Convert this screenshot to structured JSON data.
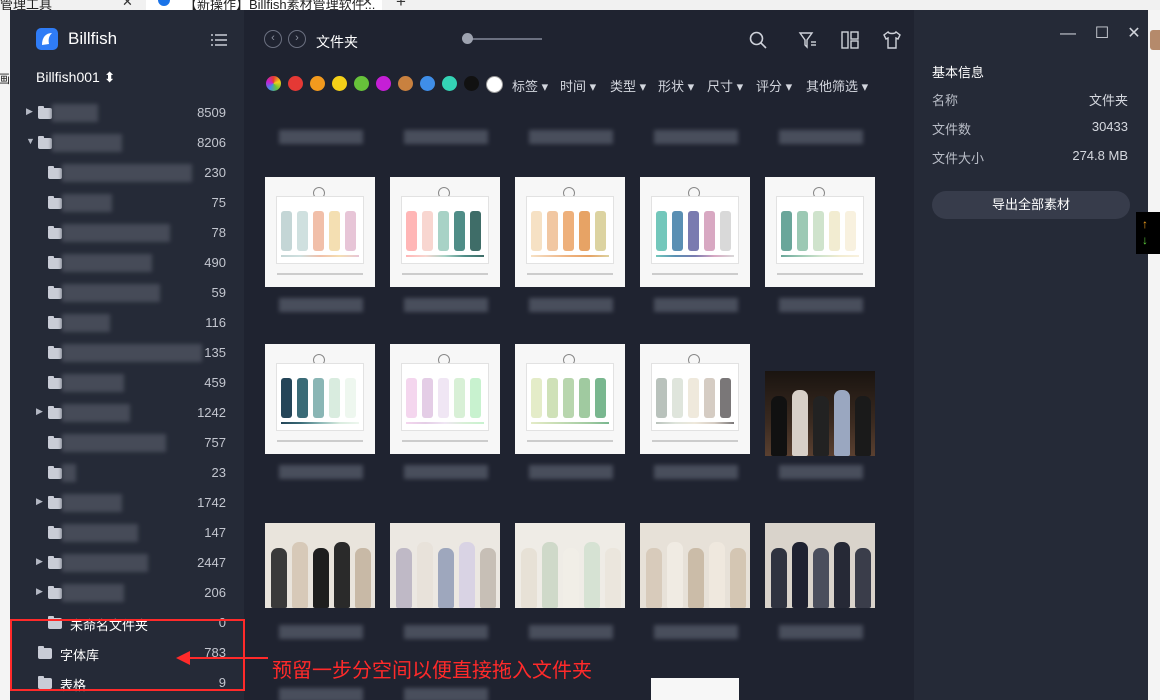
{
  "browser": {
    "tab1_title": "管理工具",
    "tab2_title": "【新操作】Billfish素材管理软件..."
  },
  "app": {
    "name": "Billfish",
    "library_name": "Billfish001 ⬍"
  },
  "sidebar": {
    "items": [
      {
        "count": "8509"
      },
      {
        "count": "8206"
      },
      {
        "count": "230"
      },
      {
        "count": "75"
      },
      {
        "count": "78"
      },
      {
        "count": "490"
      },
      {
        "count": "59"
      },
      {
        "count": "116"
      },
      {
        "count": "135"
      },
      {
        "count": "459"
      },
      {
        "count": "1242"
      },
      {
        "count": "757"
      },
      {
        "count": "23"
      },
      {
        "count": "1742"
      },
      {
        "count": "147"
      },
      {
        "count": "2447"
      },
      {
        "count": "206"
      },
      {
        "label": "未命名文件夹",
        "count": "0"
      },
      {
        "label": "字体库",
        "count": "783"
      },
      {
        "label": "表格",
        "count": "9"
      }
    ]
  },
  "toolbar": {
    "folder_title": "文件夹",
    "prev_icon": "chevron-left-icon",
    "next_icon": "chevron-right-icon",
    "icons": [
      "search-icon",
      "filter-icon",
      "layout-icon",
      "shirt-icon"
    ]
  },
  "filters": {
    "colors": [
      "#e53935",
      "#f29a1e",
      "#f4d018",
      "#67c23a",
      "#c51fd6",
      "#c9813f",
      "#3f8ee8",
      "#34d3b5",
      "#111111",
      "#ffffff"
    ],
    "labels": [
      "标签 ▾",
      "时间 ▾",
      "类型 ▾",
      "形状 ▾",
      "尺寸 ▾",
      "评分 ▾",
      "其他筛选 ▾"
    ]
  },
  "inspector": {
    "title": "基本信息",
    "rows": [
      {
        "key": "名称",
        "value": "文件夹"
      },
      {
        "key": "文件数",
        "value": "30433"
      },
      {
        "key": "文件大小",
        "value": "274.8 MB"
      }
    ],
    "export_label": "导出全部素材"
  },
  "annotation": {
    "text": "预留一步分空间以便直接拖入文件夹",
    "color": "#ff2a2a"
  },
  "palettes": [
    [
      "#c4d6d6",
      "#cfe0df",
      "#f1bfa9",
      "#f4dfb2",
      "#e7c5d7"
    ],
    [
      "#ffb6b6",
      "#f8d6d0",
      "#a8d2c6",
      "#4f8d87",
      "#3f6d68"
    ],
    [
      "#f6e1c4",
      "#f1c7a2",
      "#eeb07b",
      "#e7a365",
      "#dcd3a1"
    ],
    [
      "#73c7bb",
      "#5a8fb3",
      "#7a7bb0",
      "#d8a8c2",
      "#d9d9d9"
    ],
    [
      "#6aa69a",
      "#9cc9b4",
      "#cfe3cc",
      "#f2ecd1",
      "#f8f1df"
    ],
    [
      "#244558",
      "#3a6b77",
      "#8ab6b5",
      "#d9ecdf",
      "#eef7ef"
    ],
    [
      "#f4d6ee",
      "#e4cde6",
      "#f0e6f4",
      "#d8f0d6",
      "#c8f2cf"
    ],
    [
      "#e4ecc8",
      "#cfe1b8",
      "#b8d6ae",
      "#a0caa0",
      "#79b78f"
    ],
    [
      "#b9c2bc",
      "#dfe5dc",
      "#efe9dc",
      "#d5ccc3",
      "#7a7778"
    ]
  ]
}
